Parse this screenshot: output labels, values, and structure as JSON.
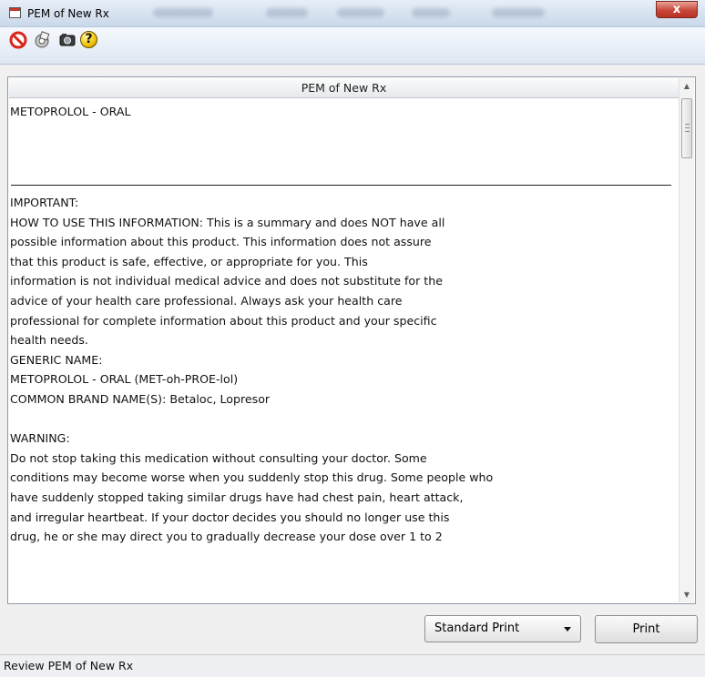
{
  "window": {
    "title": "PEM of New Rx",
    "close_glyph": "x"
  },
  "toolbar": {
    "icons": [
      "stop-icon",
      "print-setup-icon",
      "camera-icon",
      "help-icon"
    ],
    "help_glyph": "?"
  },
  "document": {
    "header": "PEM of New Rx",
    "drug_title": "METOPROLOL - ORAL",
    "lines": [
      "IMPORTANT:",
      "HOW TO USE THIS INFORMATION:  This is a summary and does NOT have all",
      "possible information about this product. This information does not assure",
      "that this product is safe, effective, or appropriate for you. This",
      "information is not individual medical advice and does not substitute for the",
      "advice of your health care professional. Always ask your health care",
      "professional for complete information about this product and your specific",
      "health needs.",
      "GENERIC NAME:",
      "METOPROLOL - ORAL (MET-oh-PROE-lol)",
      "COMMON BRAND NAME(S): Betaloc, Lopresor",
      "",
      "WARNING:",
      "Do not stop taking this medication without consulting your doctor. Some",
      "conditions may become worse when you suddenly stop this drug. Some people who",
      "have suddenly stopped taking similar drugs have had chest pain, heart attack,",
      "and irregular heartbeat. If your doctor decides you should no longer use this",
      "drug, he or she may direct you to gradually decrease your dose over 1 to 2"
    ]
  },
  "controls": {
    "print_mode": "Standard Print",
    "print_button": "Print"
  },
  "status": {
    "text": "Review PEM of New Rx"
  }
}
